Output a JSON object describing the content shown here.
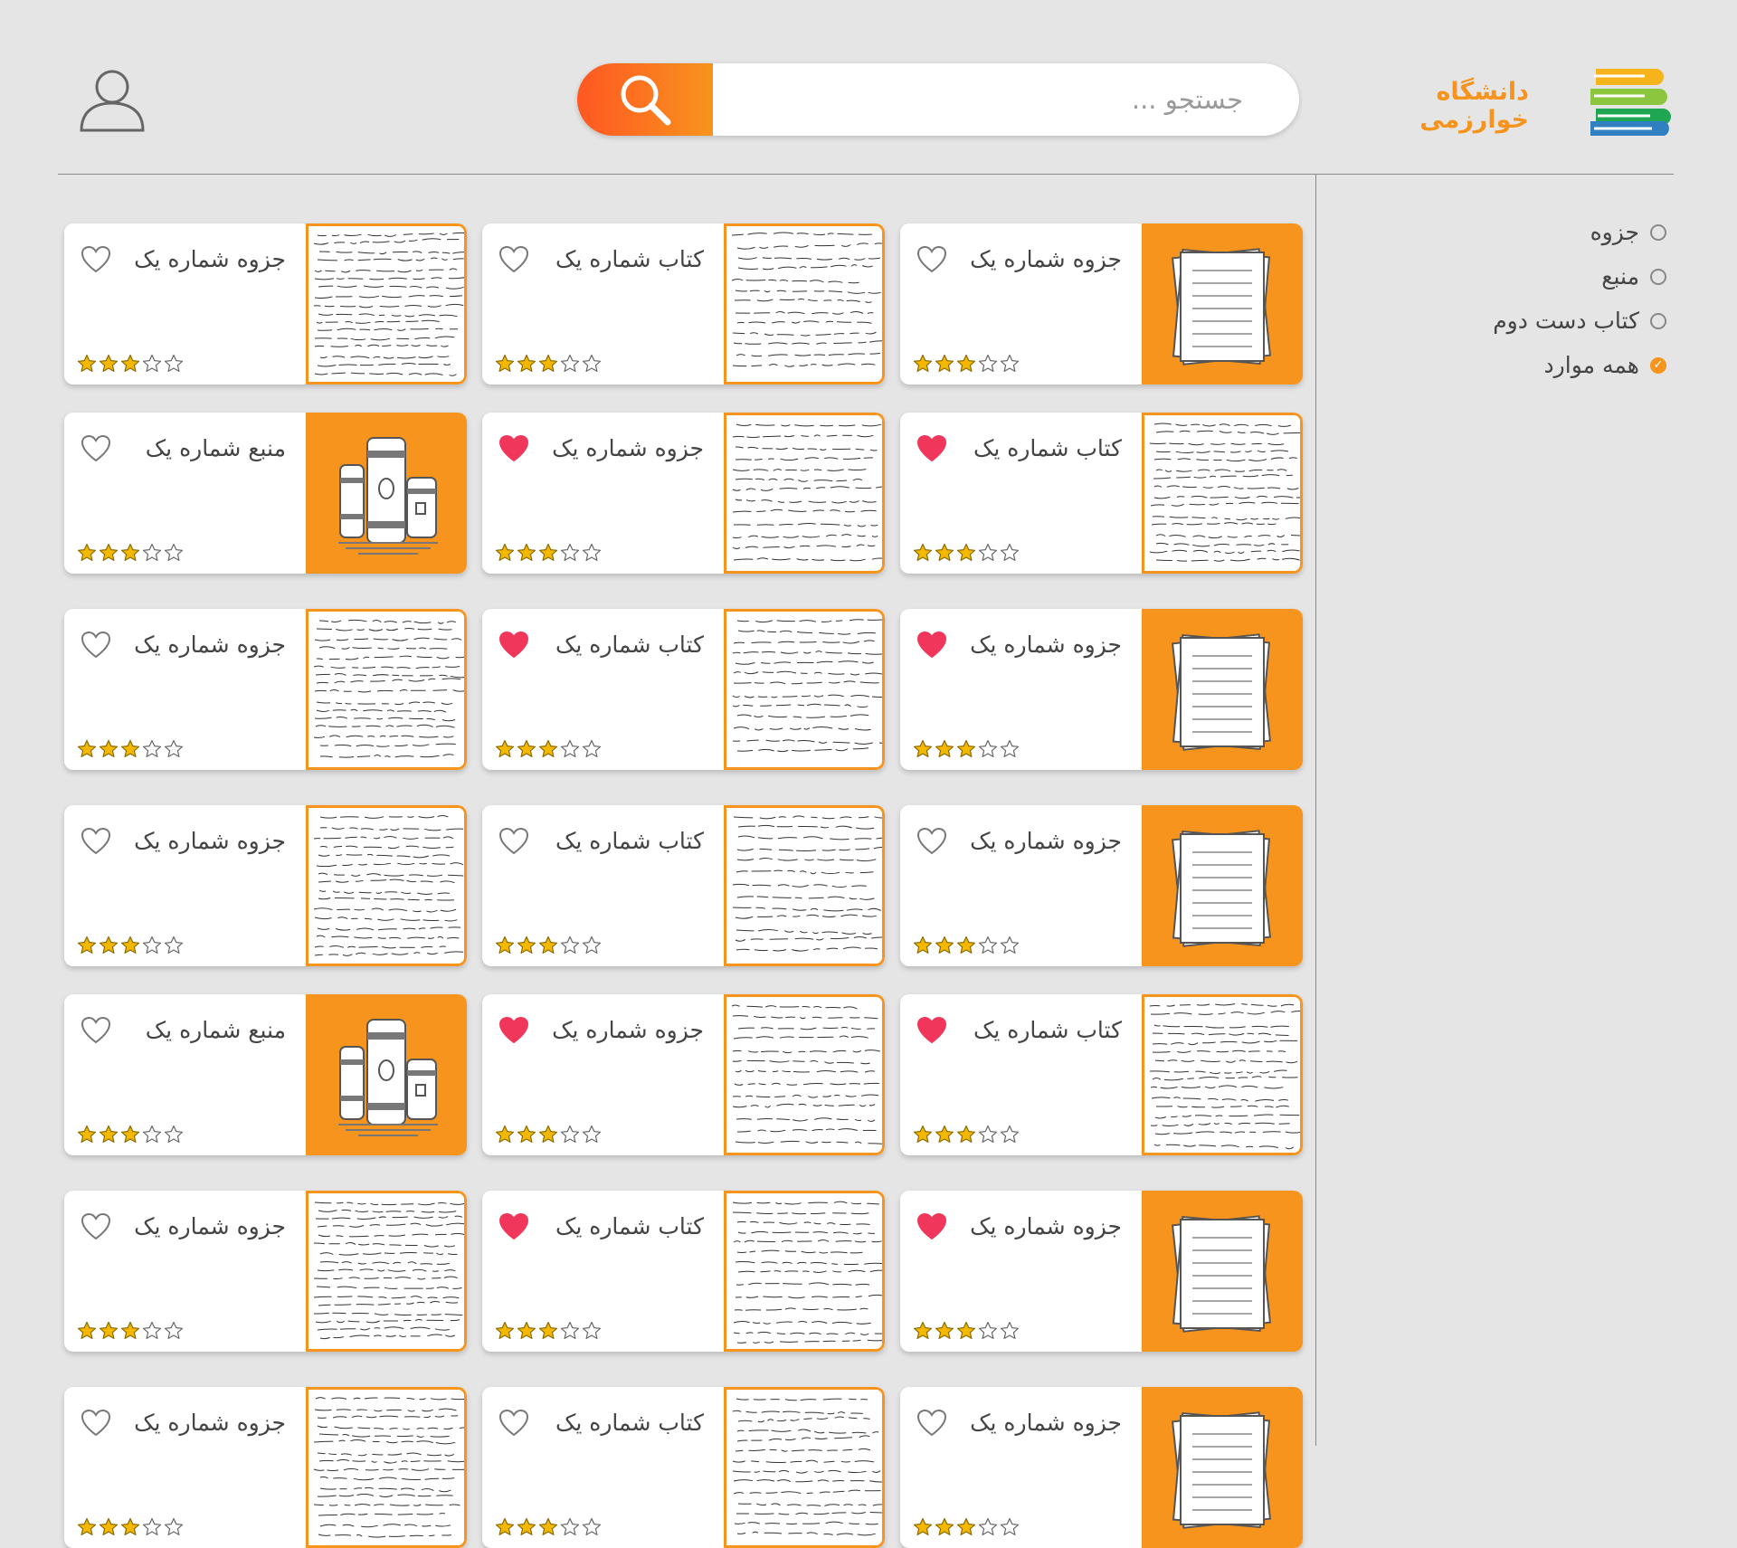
{
  "header": {
    "brand": "دانشگاه خوارزمی",
    "search_placeholder": "جستجو ...",
    "logo_icon": "stacked-books-logo",
    "search_icon": "search-icon",
    "user_icon": "user-icon"
  },
  "colors": {
    "accent": "#f7941d",
    "accent_dark": "#ff5722",
    "heart_filled": "#f0365a",
    "star": "#f5b800",
    "background": "#e5e5e5"
  },
  "filters": [
    {
      "label": "جزوه",
      "checked": false
    },
    {
      "label": "منبع",
      "checked": false
    },
    {
      "label": "کتاب دست دوم",
      "checked": false
    },
    {
      "label": "همه موارد",
      "checked": true
    }
  ],
  "cards": [
    {
      "title": "جزوه شماره یک",
      "thumb": "papers",
      "liked": false,
      "rating": 3
    },
    {
      "title": "کتاب شماره یک",
      "thumb": "notes-b",
      "liked": false,
      "rating": 3
    },
    {
      "title": "جزوه شماره یک",
      "thumb": "notes-a",
      "liked": false,
      "rating": 3
    },
    {
      "title": "کتاب شماره یک",
      "thumb": "notes-c",
      "liked": true,
      "rating": 3
    },
    {
      "title": "جزوه شماره یک",
      "thumb": "notes-c",
      "liked": true,
      "rating": 3
    },
    {
      "title": "منبع شماره یک",
      "thumb": "books",
      "liked": false,
      "rating": 3
    },
    {
      "title": "جزوه شماره یک",
      "thumb": "papers",
      "liked": true,
      "rating": 3
    },
    {
      "title": "کتاب شماره یک",
      "thumb": "notes-a",
      "liked": true,
      "rating": 3
    },
    {
      "title": "جزوه شماره یک",
      "thumb": "notes-a",
      "liked": false,
      "rating": 3
    },
    {
      "title": "جزوه شماره یک",
      "thumb": "papers",
      "liked": false,
      "rating": 3
    },
    {
      "title": "کتاب شماره یک",
      "thumb": "notes-b",
      "liked": false,
      "rating": 3
    },
    {
      "title": "جزوه شماره یک",
      "thumb": "notes-a",
      "liked": false,
      "rating": 3
    },
    {
      "title": "کتاب شماره یک",
      "thumb": "notes-c",
      "liked": true,
      "rating": 3
    },
    {
      "title": "جزوه شماره یک",
      "thumb": "notes-c",
      "liked": true,
      "rating": 3
    },
    {
      "title": "منبع شماره یک",
      "thumb": "books",
      "liked": false,
      "rating": 3
    },
    {
      "title": "جزوه شماره یک",
      "thumb": "papers",
      "liked": true,
      "rating": 3
    },
    {
      "title": "کتاب شماره یک",
      "thumb": "notes-a",
      "liked": true,
      "rating": 3
    },
    {
      "title": "جزوه شماره یک",
      "thumb": "notes-a",
      "liked": false,
      "rating": 3
    },
    {
      "title": "جزوه شماره یک",
      "thumb": "papers",
      "liked": false,
      "rating": 3
    },
    {
      "title": "کتاب شماره یک",
      "thumb": "notes-b",
      "liked": false,
      "rating": 3
    },
    {
      "title": "جزوه شماره یک",
      "thumb": "notes-a",
      "liked": false,
      "rating": 3
    }
  ]
}
